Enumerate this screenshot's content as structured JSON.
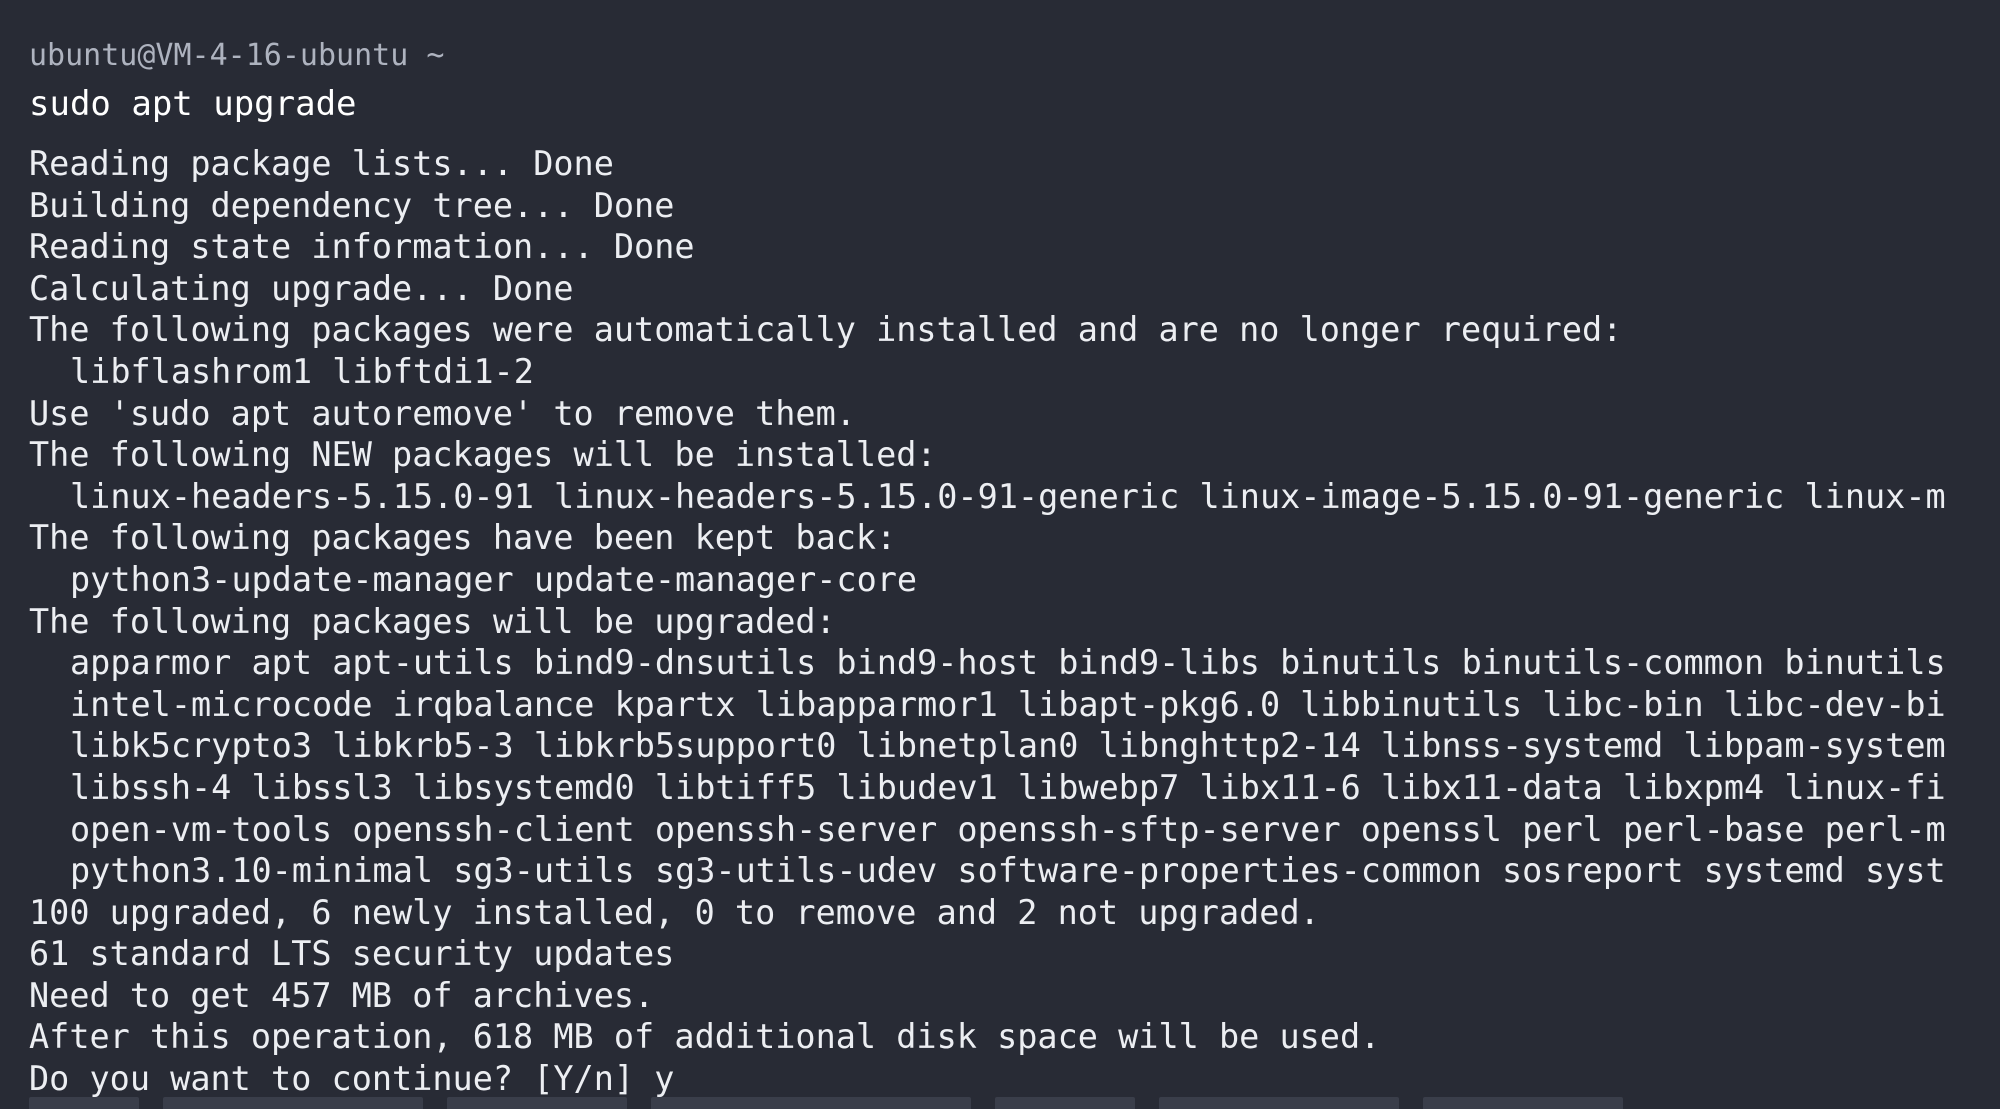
{
  "terminal": {
    "prompt": "ubuntu@VM-4-16-ubuntu ~",
    "command": "sudo apt upgrade",
    "output": [
      {
        "text": "Reading package lists... Done",
        "indent": false
      },
      {
        "text": "Building dependency tree... Done",
        "indent": false
      },
      {
        "text": "Reading state information... Done",
        "indent": false
      },
      {
        "text": "Calculating upgrade... Done",
        "indent": false
      },
      {
        "text": "The following packages were automatically installed and are no longer required:",
        "indent": false
      },
      {
        "text": "libflashrom1 libftdi1-2",
        "indent": true
      },
      {
        "text": "Use 'sudo apt autoremove' to remove them.",
        "indent": false
      },
      {
        "text": "The following NEW packages will be installed:",
        "indent": false
      },
      {
        "text": "linux-headers-5.15.0-91 linux-headers-5.15.0-91-generic linux-image-5.15.0-91-generic linux-m",
        "indent": true
      },
      {
        "text": "The following packages have been kept back:",
        "indent": false
      },
      {
        "text": "python3-update-manager update-manager-core",
        "indent": true
      },
      {
        "text": "The following packages will be upgraded:",
        "indent": false
      },
      {
        "text": "apparmor apt apt-utils bind9-dnsutils bind9-host bind9-libs binutils binutils-common binutils",
        "indent": true
      },
      {
        "text": "intel-microcode irqbalance kpartx libapparmor1 libapt-pkg6.0 libbinutils libc-bin libc-dev-bi",
        "indent": true
      },
      {
        "text": "libk5crypto3 libkrb5-3 libkrb5support0 libnetplan0 libnghttp2-14 libnss-systemd libpam-system",
        "indent": true
      },
      {
        "text": "libssh-4 libssl3 libsystemd0 libtiff5 libudev1 libwebp7 libx11-6 libx11-data libxpm4 linux-fi",
        "indent": true
      },
      {
        "text": "open-vm-tools openssh-client openssh-server openssh-sftp-server openssl perl perl-base perl-m",
        "indent": true
      },
      {
        "text": "python3.10-minimal sg3-utils sg3-utils-udev software-properties-common sosreport systemd syst",
        "indent": true
      },
      {
        "text": "100 upgraded, 6 newly installed, 0 to remove and 2 not upgraded.",
        "indent": false
      },
      {
        "text": "61 standard LTS security updates",
        "indent": false
      },
      {
        "text": "Need to get 457 MB of archives.",
        "indent": false
      },
      {
        "text": "After this operation, 618 MB of additional disk space will be used.",
        "indent": false
      },
      {
        "text": "Do you want to continue? [Y/n] y",
        "indent": false
      }
    ]
  },
  "colors": {
    "background": "#282b35",
    "prompt": "#aeb3bf",
    "command": "#ffffff",
    "output": "#eceef2"
  }
}
